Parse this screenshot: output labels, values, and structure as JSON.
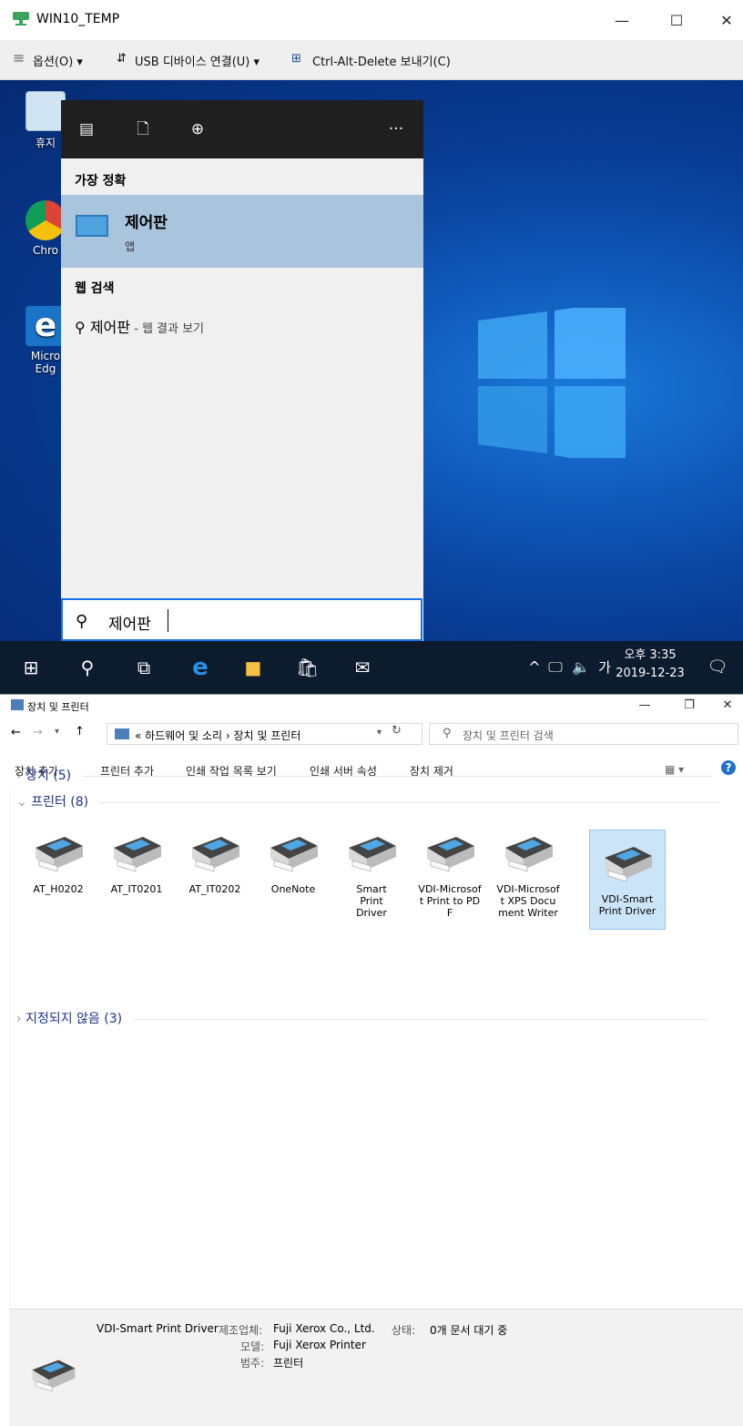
{
  "vm": {
    "title": "WIN10_TEMP",
    "toolbar": {
      "options": "옵션(O)",
      "usb": "USB 디바이스 연결(U)",
      "cad": "Ctrl-Alt-Delete 보내기(C)"
    },
    "desktop_icons": [
      "휴지",
      "Chro",
      "Micro",
      "Edg"
    ],
    "start": {
      "best_match_header": "가장 정확",
      "best_match_title": "제어판",
      "best_match_sub": "앱",
      "web_header": "웹 검색",
      "web_query": "제어판",
      "web_suffix": " - 웹 결과 보기",
      "search_value": "제어판"
    },
    "taskbar": {
      "ime": "가",
      "time": "오후 3:35",
      "date": "2019-12-23"
    }
  },
  "explorer": {
    "title": "장치 및 프린터",
    "breadcrumb": "« 하드웨어 및 소리 › 장치 및 프린터",
    "search_placeholder": "장치 및 프린터 검색",
    "commands": [
      "장치 추가",
      "프린터 추가",
      "인쇄 작업 목록 보기",
      "인쇄 서버 속성",
      "장치 제거"
    ],
    "groups": {
      "devices": "장치 (5)",
      "printers": "프린터 (8)",
      "unspecified": "지정되지 않음 (3)"
    },
    "printers": [
      "AT_H0202",
      "AT_IT0201",
      "AT_IT0202",
      "OneNote",
      "Smart Print Driver",
      "VDI-Microsoft Print to PDF",
      "VDI-Microsoft XPS Document Writer",
      "VDI-Smart Print Driver"
    ],
    "details": {
      "name": "VDI-Smart Print Driver",
      "manufacturer_label": "제조업체:",
      "manufacturer": "Fuji Xerox Co., Ltd.",
      "model_label": "모델:",
      "model": "Fuji Xerox Printer",
      "category_label": "범주:",
      "category": "프린터",
      "status_label": "상태:",
      "status": "0개 문서 대기 중"
    }
  },
  "colors": {
    "selection": "#cce4f7",
    "best_match_bg": "#a9c4dd",
    "taskbar": "#0c1b2e",
    "group_text": "#1e3287"
  }
}
